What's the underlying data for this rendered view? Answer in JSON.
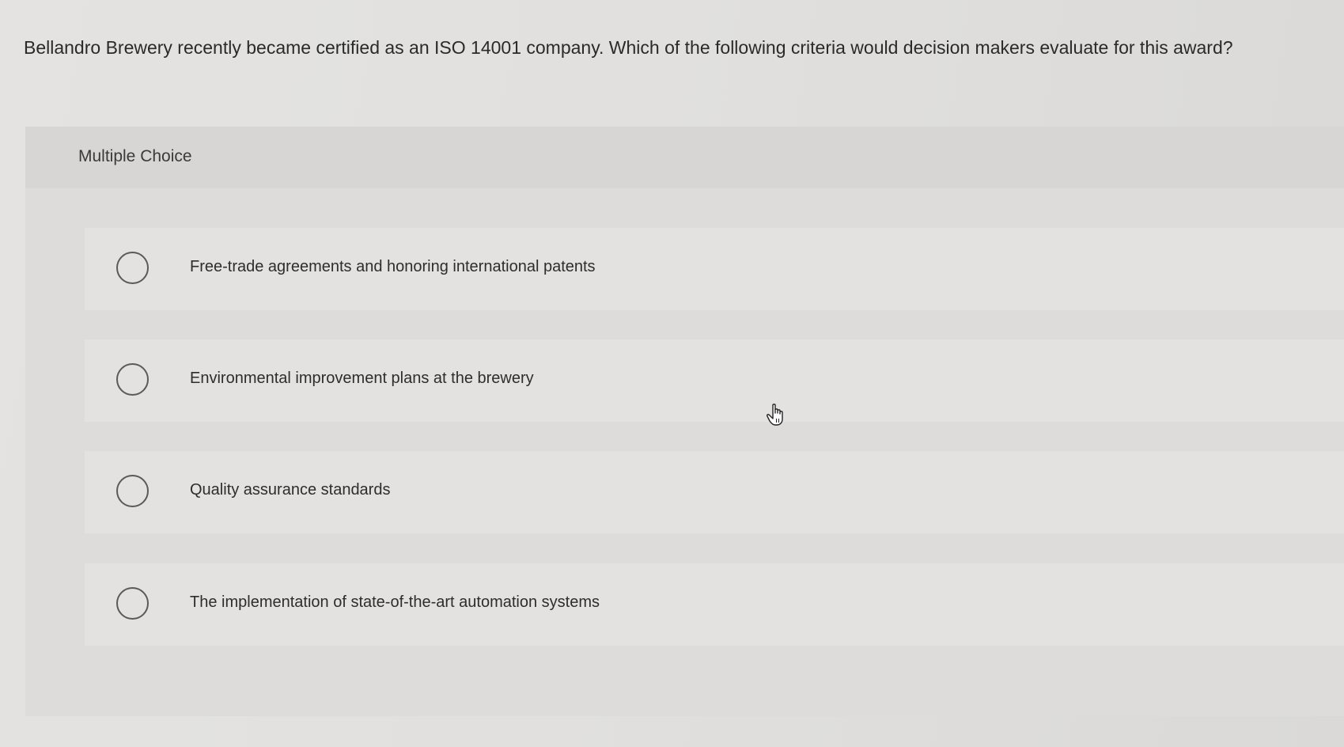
{
  "question": {
    "text": "Bellandro Brewery recently became certified as an ISO 14001 company. Which of the following criteria would decision makers evaluate for this award?"
  },
  "panel": {
    "label": "Multiple Choice"
  },
  "options": [
    {
      "label": "Free-trade agreements and honoring international patents",
      "selected": false
    },
    {
      "label": "Environmental improvement plans at the brewery",
      "selected": false
    },
    {
      "label": "Quality assurance standards",
      "selected": false
    },
    {
      "label": "The implementation of state-of-the-art automation systems",
      "selected": false
    }
  ],
  "cursor": {
    "icon": "hand-pointer-icon"
  },
  "colors": {
    "background": "#dddcda",
    "option_background": "#e3e2e0",
    "radio_border": "#5a5a5a",
    "text": "#2b2b2b"
  }
}
